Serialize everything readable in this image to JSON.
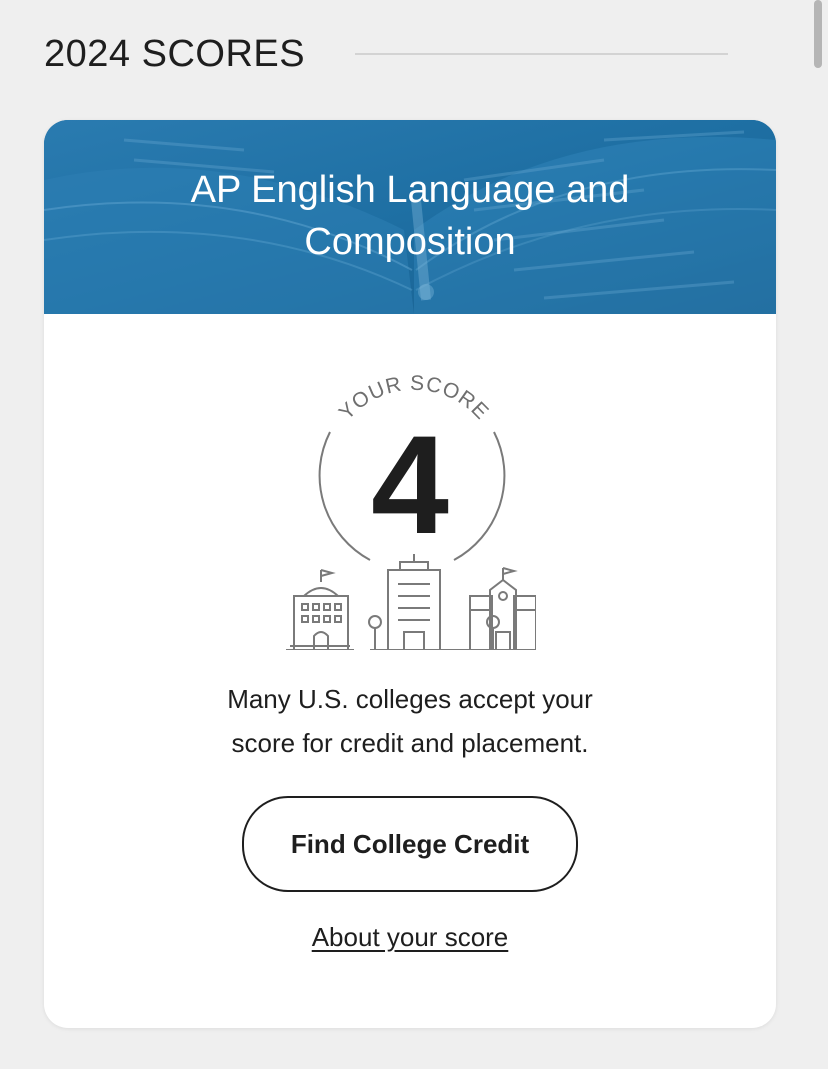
{
  "section": {
    "title": "2024 SCORES"
  },
  "card": {
    "course_title_line1": "AP English Language and",
    "course_title_line2": "Composition",
    "score_label": "YOUR SCORE",
    "score_value": "4",
    "message_line1": "Many U.S. colleges accept your",
    "message_line2": "score for credit and placement.",
    "cta_label": "Find College Credit",
    "link_label": "About your score"
  },
  "colors": {
    "header_blue": "#1c6698",
    "page_background": "#efefef",
    "card_background": "#ffffff",
    "text": "#1e1e1e"
  },
  "icons": {
    "header_background": "open-book-image",
    "illustration": "college-buildings-icon"
  }
}
